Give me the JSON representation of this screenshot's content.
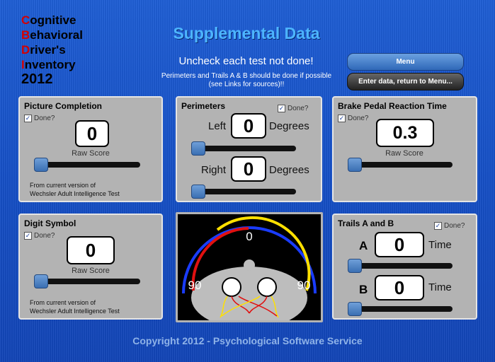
{
  "logo": {
    "lines": [
      {
        "cap": "C",
        "rest": "ognitive"
      },
      {
        "cap": "B",
        "rest": "ehavioral"
      },
      {
        "cap": "D",
        "rest": "river's"
      },
      {
        "cap": "I",
        "rest": "nventory"
      }
    ],
    "year": "2012"
  },
  "header": {
    "title": "Supplemental Data",
    "instruction": "Uncheck each test not done!",
    "note_line1": "Perimeters and Trails A & B should be done if possible",
    "note_line2": "(see Links for sources)!!"
  },
  "buttons": {
    "menu": "Menu",
    "enter": "Enter data, return to Menu..."
  },
  "done_label": "Done?",
  "check": "✓",
  "picture_completion": {
    "title": "Picture Completion",
    "value": "0",
    "label": "Raw Score",
    "source_1": "From current version of",
    "source_2": "Wechsler Adult Intelligence Test",
    "slider_fraction": 0
  },
  "perimeters": {
    "title": "Perimeters",
    "left_label": "Left",
    "right_label": "Right",
    "left_value": "0",
    "right_value": "0",
    "unit": "Degrees",
    "left_fraction": 0,
    "right_fraction": 0
  },
  "brake": {
    "title": "Brake Pedal Reaction Time",
    "value": "0.3",
    "label": "Raw Score",
    "slider_fraction": 0
  },
  "digit_symbol": {
    "title": "Digit Symbol",
    "value": "0",
    "label": "Raw Score",
    "source_1": "From current version of",
    "source_2": "Wechsler Adult Intelligence Test",
    "slider_fraction": 0
  },
  "trails": {
    "title": "Trails A and B",
    "a_label": "A",
    "b_label": "B",
    "a_value": "0",
    "b_value": "0",
    "unit": "Time",
    "a_fraction": 0,
    "b_fraction": 0
  },
  "perimeter_image": {
    "top_label": "0",
    "left_label": "90",
    "right_label": "90",
    "colors": {
      "blue": "#1a3cff",
      "red": "#e01010",
      "yellow": "#ffe000",
      "head": "#bdbdbd"
    }
  },
  "copyright": "Copyright 2012 - Psychological Software Service"
}
